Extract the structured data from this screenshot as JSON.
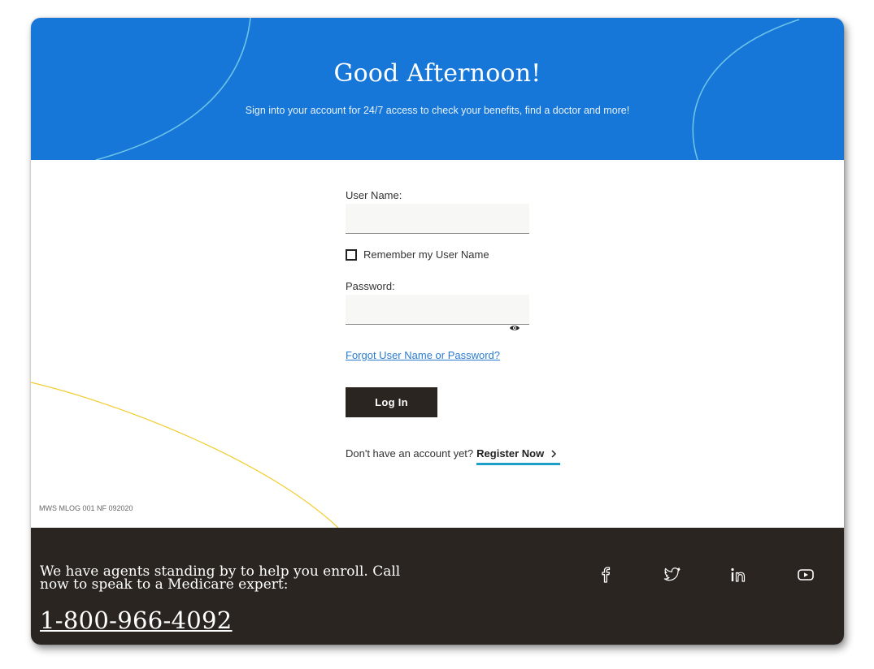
{
  "hero": {
    "title": "Good Afternoon!",
    "subtitle": "Sign into your account for 24/7 access to check your benefits, find a doctor and more!",
    "background_color": "#1677d9"
  },
  "login_form": {
    "username_label": "User Name:",
    "username_value": "",
    "remember_label": "Remember my User Name",
    "remember_checked": false,
    "password_label": "Password:",
    "password_value": "",
    "show_password_icon": "eye-icon",
    "forgot_link": "Forgot User Name or Password?",
    "login_button": "Log In",
    "no_account_text": "Don't have an account yet?",
    "register_link": "Register Now",
    "register_icon": "chevron-right-icon"
  },
  "page_code": "MWS MLOG 001 NF 092020",
  "footer": {
    "agent_text": "We have agents standing by to help you enroll. Call now to speak to a Medicare expert:",
    "phone": "1-800-966-4092",
    "background_color": "#2a2520",
    "social": [
      "facebook-icon",
      "twitter-icon",
      "linkedin-icon",
      "youtube-icon"
    ]
  },
  "colors": {
    "link": "#2b7bd0",
    "accent_underline": "#1ca0c9",
    "decorative_yellow": "#f2cc2e"
  }
}
